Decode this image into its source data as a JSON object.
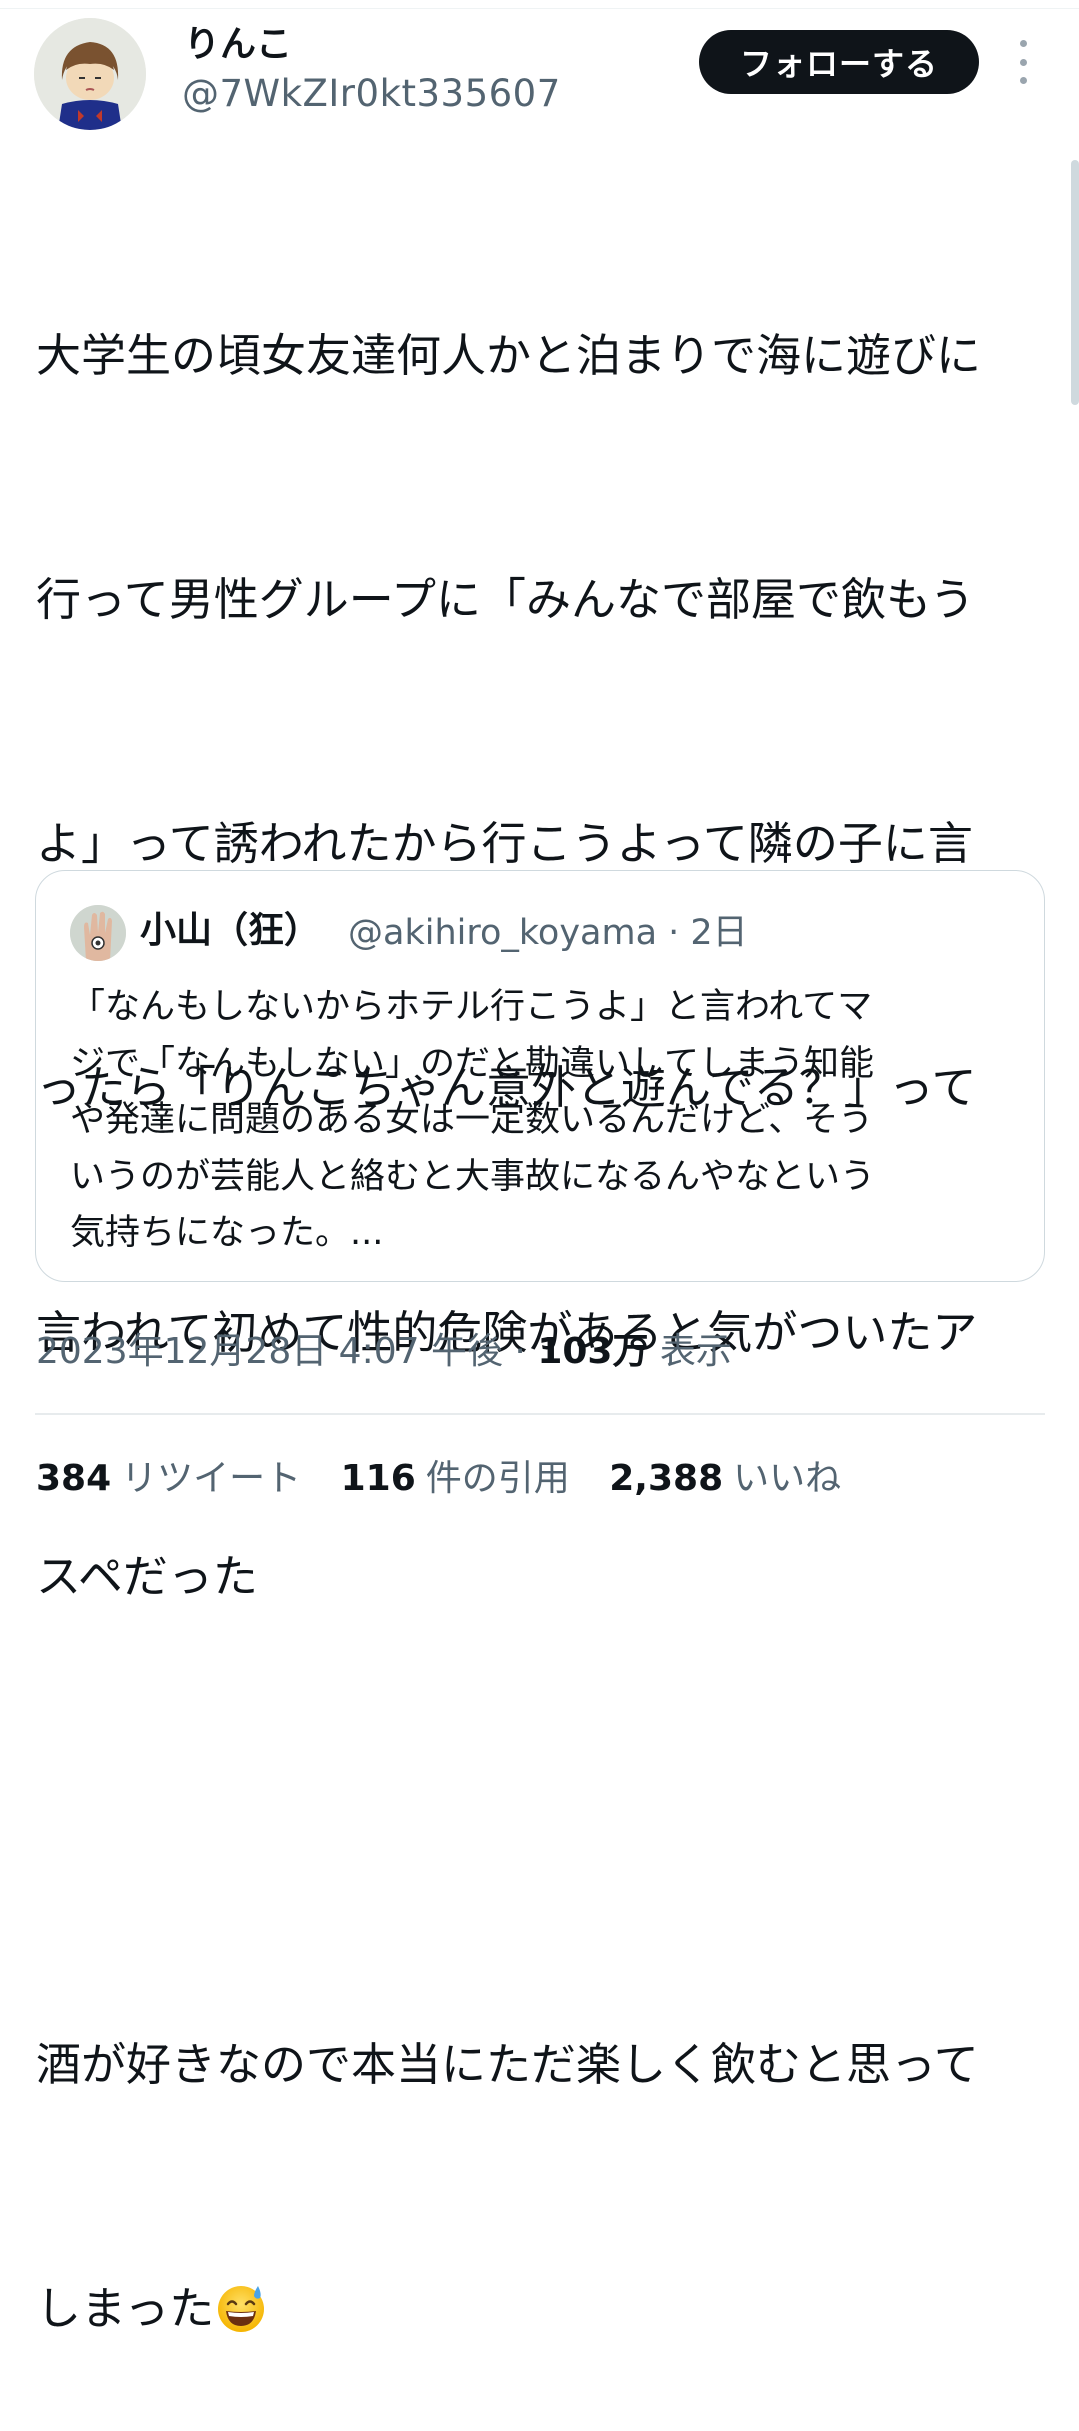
{
  "author": {
    "name": "りんこ",
    "handle": "@7WkZIr0kt335607",
    "follow_label": "フォローする"
  },
  "tweet": {
    "lines": [
      "大学生の頃女友達何人かと泊まりで海に遊びに",
      "行って男性グループに「みんなで部屋で飲もう",
      "よ」って誘われたから行こうよって隣の子に言",
      "ったら「りんこちゃん意外と遊んでる？」って",
      "言われて初めて性的危険があると気がついたア",
      "スペだった",
      "",
      "酒が好きなので本当にただ楽しく飲むと思って",
      "しまった"
    ],
    "emoji": "grinning-face-with-sweat"
  },
  "quoted": {
    "name": "小山（狂）",
    "handle_time": "@akihiro_koyama · 2日",
    "lines": [
      "「なんもしないからホテル行こうよ」と言われてマ",
      "ジで「なんもしない」のだと勘違いしてしまう知能",
      "や発達に問題のある女は一定数いるんだけど、そう",
      "いうのが芸能人と絡むと大事故になるんやなという",
      "気持ちになった。..."
    ]
  },
  "meta": {
    "timestamp": "2023年12月28日 4:07 午後",
    "separator": " · ",
    "views_count": "103万",
    "views_label": "表示"
  },
  "stats": {
    "retweets_count": "384",
    "retweets_label": "リツイート",
    "quotes_count": "116",
    "quotes_label": "件の引用",
    "likes_count": "2,388",
    "likes_label": "いいね"
  }
}
